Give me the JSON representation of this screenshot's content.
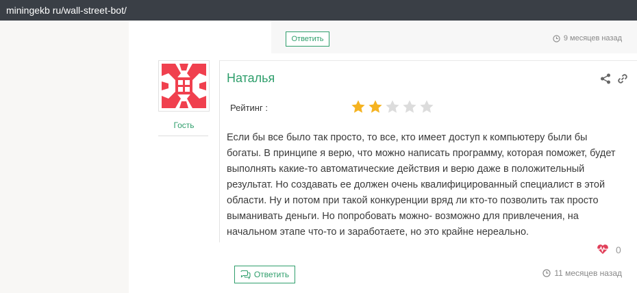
{
  "browser": {
    "url": "miningekb ru/wall-street-bot/"
  },
  "previous_comment": {
    "reply_label": "Ответить",
    "time": "9 месяцев назад"
  },
  "comment": {
    "author": "Наталья",
    "role": "Гость",
    "rating_label": "Рейтинг :",
    "rating": 2,
    "rating_max": 5,
    "text": "Если бы все было так просто, то все, кто имеет доступ к компьютеру были бы богаты. В принципе я верю, что можно написать программу, которая поможет, будет выполнять какие-то автоматические действия и верю даже в положительный результат. Но создавать ее должен очень квалифицированный специалист в этой области. Ну и потом при такой конкуренции вряд ли кто-то позволить так просто выманивать деньги. Но попробовать можно- возможно для привлечения, на начальном этапе что-то и заработаете, но это крайне нереально.",
    "likes": "0",
    "reply_label": "Ответить",
    "time": "11 месяцев назад"
  },
  "colors": {
    "accent": "#2e9e6b",
    "star_filled": "#f5b321",
    "star_empty": "#dcdcdc",
    "like": "#e0405a",
    "avatar_red": "#f0404e"
  },
  "icons": [
    "share-icon",
    "link-icon",
    "star-icon",
    "heart-pulse-icon",
    "comment-icon",
    "clock-icon"
  ]
}
